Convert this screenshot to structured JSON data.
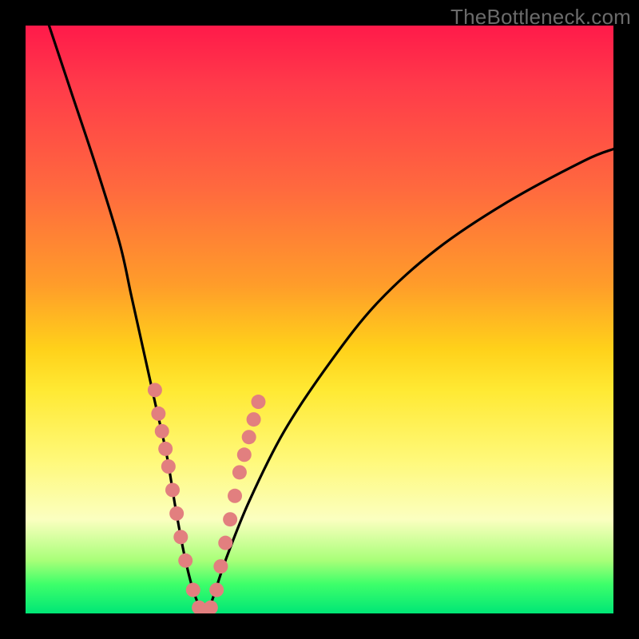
{
  "watermark": "TheBottleneck.com",
  "chart_data": {
    "type": "line",
    "title": "",
    "xlabel": "",
    "ylabel": "",
    "xlim": [
      0,
      100
    ],
    "ylim": [
      0,
      100
    ],
    "series": [
      {
        "name": "bottleneck-curve",
        "x": [
          4,
          8,
          12,
          16,
          18,
          20,
          22,
          24,
          25.5,
          27,
          28.5,
          30,
          31,
          32,
          34,
          38,
          44,
          52,
          60,
          70,
          82,
          95,
          100
        ],
        "y": [
          100,
          88,
          76,
          63,
          54,
          45,
          36,
          27,
          18,
          10,
          4,
          0.5,
          0.5,
          3,
          9,
          19,
          31,
          43,
          53,
          62,
          70,
          77,
          79
        ]
      }
    ],
    "markers": [
      {
        "name": "scatter-dots",
        "color": "#e27f7f",
        "points": [
          {
            "x": 22.0,
            "y": 38
          },
          {
            "x": 22.6,
            "y": 34
          },
          {
            "x": 23.2,
            "y": 31
          },
          {
            "x": 23.8,
            "y": 28
          },
          {
            "x": 24.3,
            "y": 25
          },
          {
            "x": 25.0,
            "y": 21
          },
          {
            "x": 25.7,
            "y": 17
          },
          {
            "x": 26.4,
            "y": 13
          },
          {
            "x": 27.2,
            "y": 9
          },
          {
            "x": 28.5,
            "y": 4
          },
          {
            "x": 29.5,
            "y": 1
          },
          {
            "x": 30.5,
            "y": 0.5
          },
          {
            "x": 31.5,
            "y": 1
          },
          {
            "x": 32.5,
            "y": 4
          },
          {
            "x": 33.2,
            "y": 8
          },
          {
            "x": 34.0,
            "y": 12
          },
          {
            "x": 34.8,
            "y": 16
          },
          {
            "x": 35.6,
            "y": 20
          },
          {
            "x": 36.4,
            "y": 24
          },
          {
            "x": 37.2,
            "y": 27
          },
          {
            "x": 38.0,
            "y": 30
          },
          {
            "x": 38.8,
            "y": 33
          },
          {
            "x": 39.6,
            "y": 36
          }
        ]
      }
    ]
  }
}
